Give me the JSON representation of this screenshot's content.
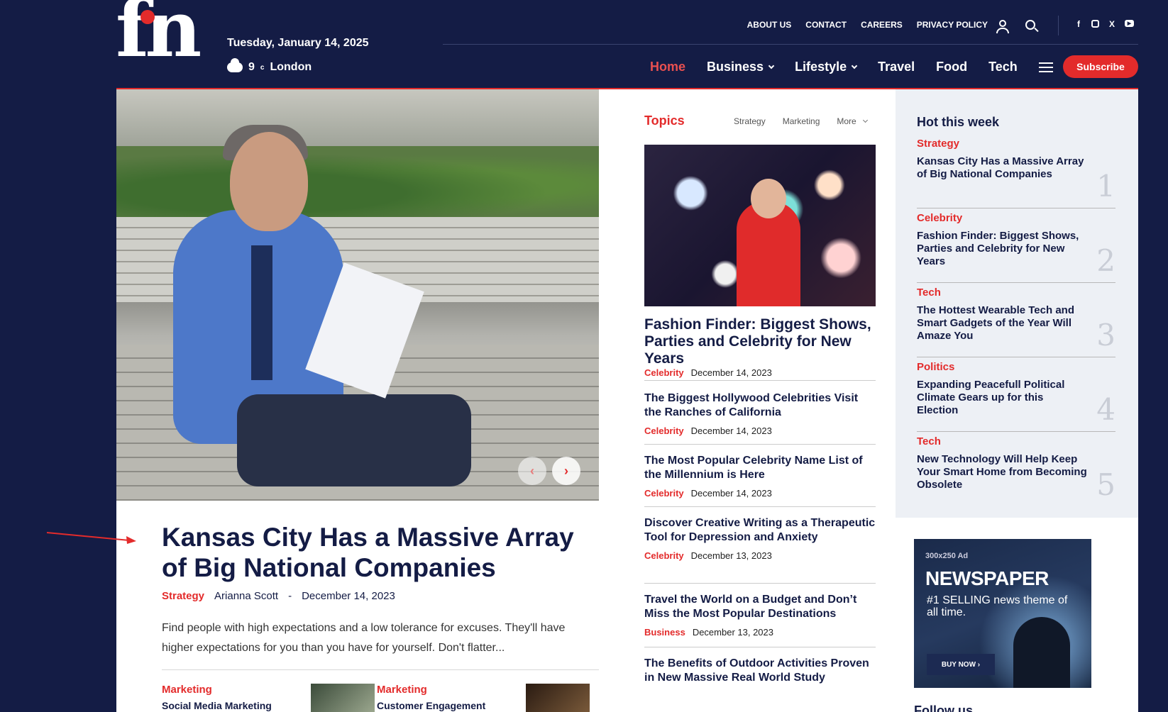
{
  "header": {
    "logo_text": "fn",
    "date": "Tuesday, January 14, 2025",
    "weather": {
      "temp": "9",
      "unit": "c",
      "city": "London",
      "icon": "cloud-icon"
    },
    "top_links": [
      "ABOUT US",
      "CONTACT",
      "CAREERS",
      "PRIVACY POLICY"
    ],
    "social": [
      "f",
      "ig",
      "X",
      "▶"
    ],
    "nav": {
      "home": "Home",
      "business": "Business",
      "lifestyle": "Lifestyle",
      "travel": "Travel",
      "food": "Food",
      "tech": "Tech"
    },
    "subscribe": "Subscribe"
  },
  "hero": {
    "title": "Kansas City Has a Massive Array of Big National Companies",
    "category": "Strategy",
    "author": "Arianna Scott",
    "dash": "-",
    "date": "December 14, 2023",
    "excerpt": "Find people with high expectations and a low tolerance for excuses. They'll have higher expectations for you than you have for yourself. Don't flatter...",
    "prev": "‹",
    "next": "›"
  },
  "mini_articles": [
    {
      "category": "Marketing",
      "title": "Social Media Marketing"
    },
    {
      "category": "Marketing",
      "title": "Customer Engagement"
    }
  ],
  "topics": {
    "title": "Topics",
    "tabs": [
      "Strategy",
      "Marketing",
      "More"
    ],
    "featured_title": "Fashion Finder: Biggest Shows, Parties and Celebrity for New Years",
    "featured_category": "Celebrity",
    "featured_date": "December 14, 2023",
    "articles": [
      {
        "title": "The Biggest Hollywood Celebrities Visit the Ranches of California",
        "category": "Celebrity",
        "date": "December 14, 2023"
      },
      {
        "title": "The Most Popular Celebrity Name List of the Millennium is Here",
        "category": "Celebrity",
        "date": "December 14, 2023"
      },
      {
        "title": "Discover Creative Writing as a Therapeutic Tool for Depression and Anxiety",
        "category": "Celebrity",
        "date": "December 13, 2023"
      },
      {
        "title": "Travel the World on a Budget and Don’t Miss the Most Popular Destinations",
        "category": "Business",
        "date": "December 13, 2023"
      },
      {
        "title": "The Benefits of Outdoor Activities Proven in New Massive Real World Study"
      }
    ]
  },
  "hot": {
    "title": "Hot this week",
    "items": [
      {
        "category": "Strategy",
        "title": "Kansas City Has a Massive Array of Big National Companies",
        "num": "1"
      },
      {
        "category": "Celebrity",
        "title": "Fashion Finder: Biggest Shows, Parties and Celebrity for New Years",
        "num": "2"
      },
      {
        "category": "Tech",
        "title": "The Hottest Wearable Tech and Smart Gadgets of the Year Will Amaze You",
        "num": "3"
      },
      {
        "category": "Politics",
        "title": "Expanding Peacefull Political Climate Gears up for this Election",
        "num": "4"
      },
      {
        "category": "Tech",
        "title": "New Technology Will Help Keep Your Smart Home from Becoming Obsolete",
        "num": "5"
      }
    ]
  },
  "ad": {
    "label": "300x250 Ad",
    "brand": "NEWSPAPER",
    "tagline": "#1 SELLING news theme of all time.",
    "button": "BUY NOW ›"
  },
  "follow_title": "Follow us",
  "colors": {
    "navy": "#141c45",
    "accent": "#e32b2b",
    "panel": "#edf0f5"
  }
}
